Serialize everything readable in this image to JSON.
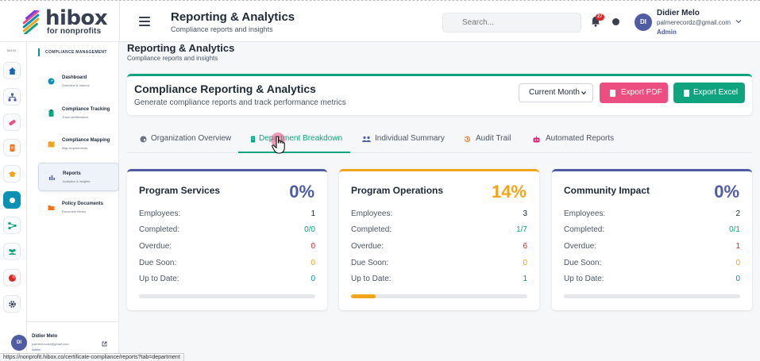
{
  "brand": {
    "name": "hibox",
    "tagline": "for nonprofits"
  },
  "header": {
    "title": "Reporting & Analytics",
    "subtitle": "Compliance reports and insights",
    "search_placeholder": "Search...",
    "notification_count": "27",
    "user": {
      "initials": "DI",
      "name": "Didier Melo",
      "email": "palmerecordz@gmail.com",
      "role": "Admin"
    }
  },
  "rail": {
    "label": "MAIN",
    "items": [
      "home-icon",
      "org-chart-icon",
      "pill-icon",
      "document-icon",
      "graduation-icon",
      "circle-icon",
      "share-icon",
      "users-icon",
      "chart-pie-icon",
      "gear-icon"
    ]
  },
  "subnav": {
    "heading": "COMPLIANCE MANAGEMENT",
    "items": [
      {
        "title": "Dashboard",
        "desc": "Overview & metrics",
        "icon": "dashboard-icon",
        "color": "#0891b2"
      },
      {
        "title": "Compliance Tracking",
        "desc": "Track certifications",
        "icon": "clipboard-icon",
        "color": "#10a37f"
      },
      {
        "title": "Compliance Mapping",
        "desc": "Map requirements",
        "icon": "map-icon",
        "color": "#f2a41c"
      },
      {
        "title": "Reports",
        "desc": "Analytics & insights",
        "icon": "bar-chart-icon",
        "color": "#4f5ba3"
      },
      {
        "title": "Policy Documents",
        "desc": "Document library",
        "icon": "folder-icon",
        "color": "#f97316"
      }
    ],
    "active_index": 3,
    "user": {
      "initials": "DI",
      "name": "Didier Melo",
      "email": "palmerecordz@gmail.com",
      "role": "Admin"
    }
  },
  "page": {
    "title": "Reporting & Analytics",
    "subtitle": "Compliance reports and insights"
  },
  "hero": {
    "title": "Compliance Reporting & Analytics",
    "subtitle": "Generate compliance reports and track performance metrics",
    "period_selected": "Current Month",
    "export_pdf_label": "Export PDF",
    "export_excel_label": "Export Excel"
  },
  "tabs": [
    {
      "label": "Organization Overview",
      "icon": "palette-icon"
    },
    {
      "label": "Department Breakdown",
      "icon": "building-icon"
    },
    {
      "label": "Individual Summary",
      "icon": "users-icon"
    },
    {
      "label": "Audit Trail",
      "icon": "history-icon"
    },
    {
      "label": "Automated Reports",
      "icon": "robot-icon"
    }
  ],
  "active_tab": 1,
  "row_labels": {
    "employees": "Employees:",
    "completed": "Completed:",
    "overdue": "Overdue:",
    "due_soon": "Due Soon:",
    "up_to_date": "Up to Date:"
  },
  "departments": [
    {
      "name": "Program Services",
      "percent": "0%",
      "employees": "1",
      "completed": "0/0",
      "overdue": "0",
      "due_soon": "0",
      "up_to_date": "0",
      "progress": 0,
      "accent": "#4f5ba3"
    },
    {
      "name": "Program Operations",
      "percent": "14%",
      "employees": "3",
      "completed": "1/7",
      "overdue": "6",
      "due_soon": "0",
      "up_to_date": "1",
      "progress": 14,
      "accent": "#f2a41c"
    },
    {
      "name": "Community Impact",
      "percent": "0%",
      "employees": "2",
      "completed": "0/1",
      "overdue": "1",
      "due_soon": "0",
      "up_to_date": "0",
      "progress": 0,
      "accent": "#4f5ba3"
    }
  ],
  "status_url": "https://nonprofit.hibox.co/certificate-compliance/reports?tab=department"
}
